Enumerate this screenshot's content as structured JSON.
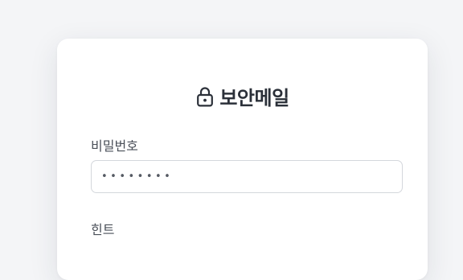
{
  "card": {
    "title": "보안메일",
    "title_icon": "lock-icon"
  },
  "form": {
    "password_label": "비밀번호",
    "password_value": "••••••••",
    "hint_label": "힌트"
  },
  "colors": {
    "background": "#f4f5f7",
    "card": "#ffffff",
    "title_text": "#2b3039",
    "label_text": "#4a4f58",
    "input_border": "#d4d7dc"
  }
}
